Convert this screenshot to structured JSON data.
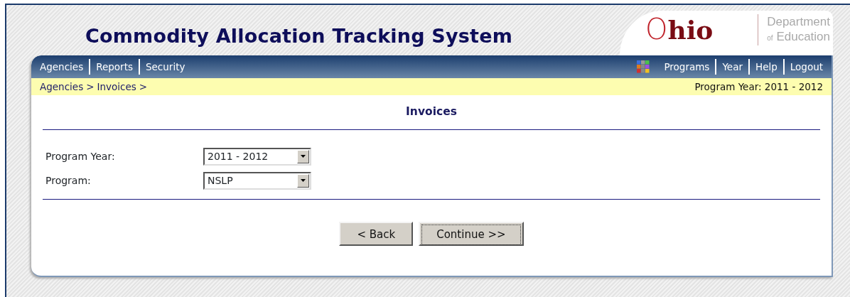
{
  "header": {
    "title": "Commodity Allocation Tracking System",
    "logo": {
      "wordmark": "Ohio",
      "department_line_1": "Department",
      "department_line_2_small": "of",
      "department_line_2": "Education"
    }
  },
  "nav_left": [
    {
      "label": "Agencies"
    },
    {
      "label": "Reports"
    },
    {
      "label": "Security"
    }
  ],
  "nav_right": [
    {
      "label": "Programs"
    },
    {
      "label": "Year"
    },
    {
      "label": "Help"
    },
    {
      "label": "Logout"
    }
  ],
  "breadcrumb": {
    "items": [
      {
        "label": "Agencies"
      },
      {
        "label": "Invoices"
      }
    ],
    "separator": ">",
    "program_year": "Program Year: 2011 - 2012"
  },
  "page_title": "Invoices",
  "form": [
    {
      "label": "Program Year:",
      "value": "2011 - 2012"
    },
    {
      "label": "Program:",
      "value": "NSLP"
    }
  ],
  "buttons": [
    {
      "label": "< Back",
      "focused": false
    },
    {
      "label": "Continue >>",
      "focused": true
    }
  ]
}
